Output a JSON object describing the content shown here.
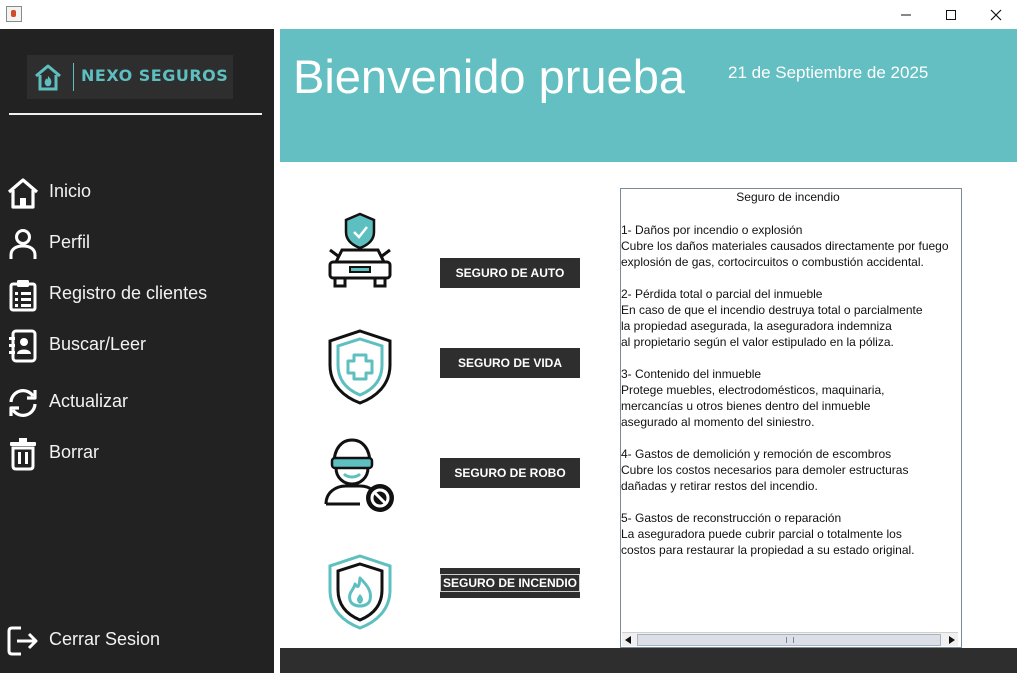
{
  "window": {
    "title": "",
    "controls": [
      "minimize-icon",
      "maximize-icon",
      "close-icon"
    ]
  },
  "sidebar": {
    "logo_text": "NEXO SEGUROS",
    "items": [
      {
        "label": "Inicio",
        "icon": "home-icon"
      },
      {
        "label": "Perfil",
        "icon": "user-icon"
      },
      {
        "label": "Registro de clientes",
        "icon": "clipboard-icon"
      },
      {
        "label": "Buscar/Leer",
        "icon": "contact-book-icon"
      },
      {
        "label": "Actualizar",
        "icon": "refresh-icon"
      },
      {
        "label": "Borrar",
        "icon": "trash-icon"
      }
    ],
    "logout_label": "Cerrar Sesion",
    "logout_icon": "logout-icon"
  },
  "header": {
    "title": "Bienvenido prueba",
    "date": "21 de Septiembre de 2025"
  },
  "insurances": [
    {
      "label": "SEGURO DE AUTO",
      "icon": "car-shield-icon"
    },
    {
      "label": "SEGURO DE VIDA",
      "icon": "health-shield-icon"
    },
    {
      "label": "SEGURO DE ROBO",
      "icon": "thief-icon"
    },
    {
      "label": "SEGURO DE INCENDIO",
      "icon": "fire-shield-icon"
    }
  ],
  "details": {
    "title": "Seguro de incendio",
    "lines": [
      "1- Daños por incendio o explosión",
      "Cubre los daños materiales causados directamente por fuego",
      "explosión de gas, cortocircuitos o combustión accidental.",
      "",
      "2- Pérdida total o parcial del inmueble",
      "En caso de que el incendio destruya total o parcialmente",
      "la propiedad asegurada, la aseguradora indemniza",
      "al propietario según el valor estipulado en la póliza.",
      "",
      "3- Contenido del inmueble",
      "Protege muebles, electrodomésticos, maquinaria,",
      "mercancías u otros bienes dentro del inmueble",
      "asegurado al momento del siniestro.",
      "",
      "4- Gastos de demolición y remoción de escombros",
      "Cubre los costos necesarios para demoler estructuras",
      "dañadas y retirar restos del incendio.",
      "",
      "5- Gastos de reconstrucción o reparación",
      "La aseguradora puede cubrir parcial o totalmente los",
      "costos para restaurar la propiedad a su estado original."
    ]
  },
  "colors": {
    "accent": "#63bfc1",
    "sidebar": "#222222",
    "button": "#2e2e2e"
  }
}
